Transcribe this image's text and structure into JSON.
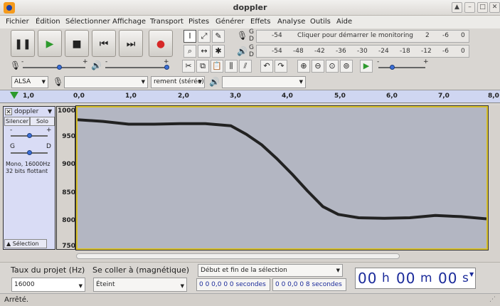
{
  "window": {
    "title": "doppler"
  },
  "menu": [
    "Fichier",
    "Édition",
    "Sélectionner",
    "Affichage",
    "Transport",
    "Pistes",
    "Générer",
    "Effets",
    "Analyse",
    "Outils",
    "Aide"
  ],
  "meters": {
    "record_channel_top": "G",
    "record_channel_bottom": "D",
    "record_monitor_text": "Cliquer pour démarrer le monitoring",
    "play_channel_top": "G",
    "play_channel_bottom": "D",
    "record_scale": [
      "-54",
      "2",
      "-6",
      "0"
    ],
    "play_scale": [
      "-54",
      "-48",
      "-42",
      "-36",
      "-30",
      "-24",
      "-18",
      "-12",
      "-6",
      "0"
    ]
  },
  "device": {
    "host": "ALSA",
    "output_channels": "rement (stéréo)"
  },
  "ruler": {
    "start_label": "1,0",
    "ticks": [
      "0,0",
      "1,0",
      "2,0",
      "3,0",
      "4,0",
      "5,0",
      "6,0",
      "7,0",
      "8,0"
    ]
  },
  "track": {
    "name": "doppler",
    "mute_label": "Silencer",
    "solo_label": "Solo",
    "gain_minus": "-",
    "gain_plus": "+",
    "pan_left": "G",
    "pan_right": "D",
    "info_line1": "Mono, 16000Hz",
    "info_line2": "32 bits flottant",
    "select_label": "Sélection",
    "y_ticks": [
      "1000",
      "950",
      "900",
      "850",
      "800",
      "750"
    ]
  },
  "chart_data": {
    "type": "line",
    "x": [
      0.0,
      0.5,
      1.0,
      1.5,
      2.0,
      2.5,
      3.0,
      3.3,
      3.6,
      3.9,
      4.2,
      4.5,
      4.8,
      5.1,
      5.5,
      6.0,
      6.5,
      7.0,
      7.5,
      8.0
    ],
    "values": [
      978,
      975,
      970,
      970,
      971,
      971,
      967,
      952,
      933,
      908,
      880,
      850,
      822,
      808,
      802,
      801,
      802,
      806,
      804,
      800
    ],
    "y_ticks": [
      "1000",
      "950",
      "900",
      "850",
      "800",
      "750"
    ],
    "ylim": [
      747,
      1000
    ],
    "xlim": [
      0,
      8
    ],
    "color": "#222222"
  },
  "bottom": {
    "rate_label": "Taux du projet (Hz)",
    "rate_value": "16000",
    "snap_label": "Se coller à (magnétique)",
    "snap_value": "Éteint",
    "selection_mode": "Début et fin de la sélection",
    "sel_start": "0 0 0,0 0 0",
    "sel_end": "0 0 0,0 0 8",
    "sel_unit": "secondes",
    "time_h": "00",
    "time_m": "00",
    "time_s": "00",
    "time_h_unit": "h",
    "time_m_unit": "m",
    "time_s_unit": "s"
  },
  "status": "Arrêté."
}
